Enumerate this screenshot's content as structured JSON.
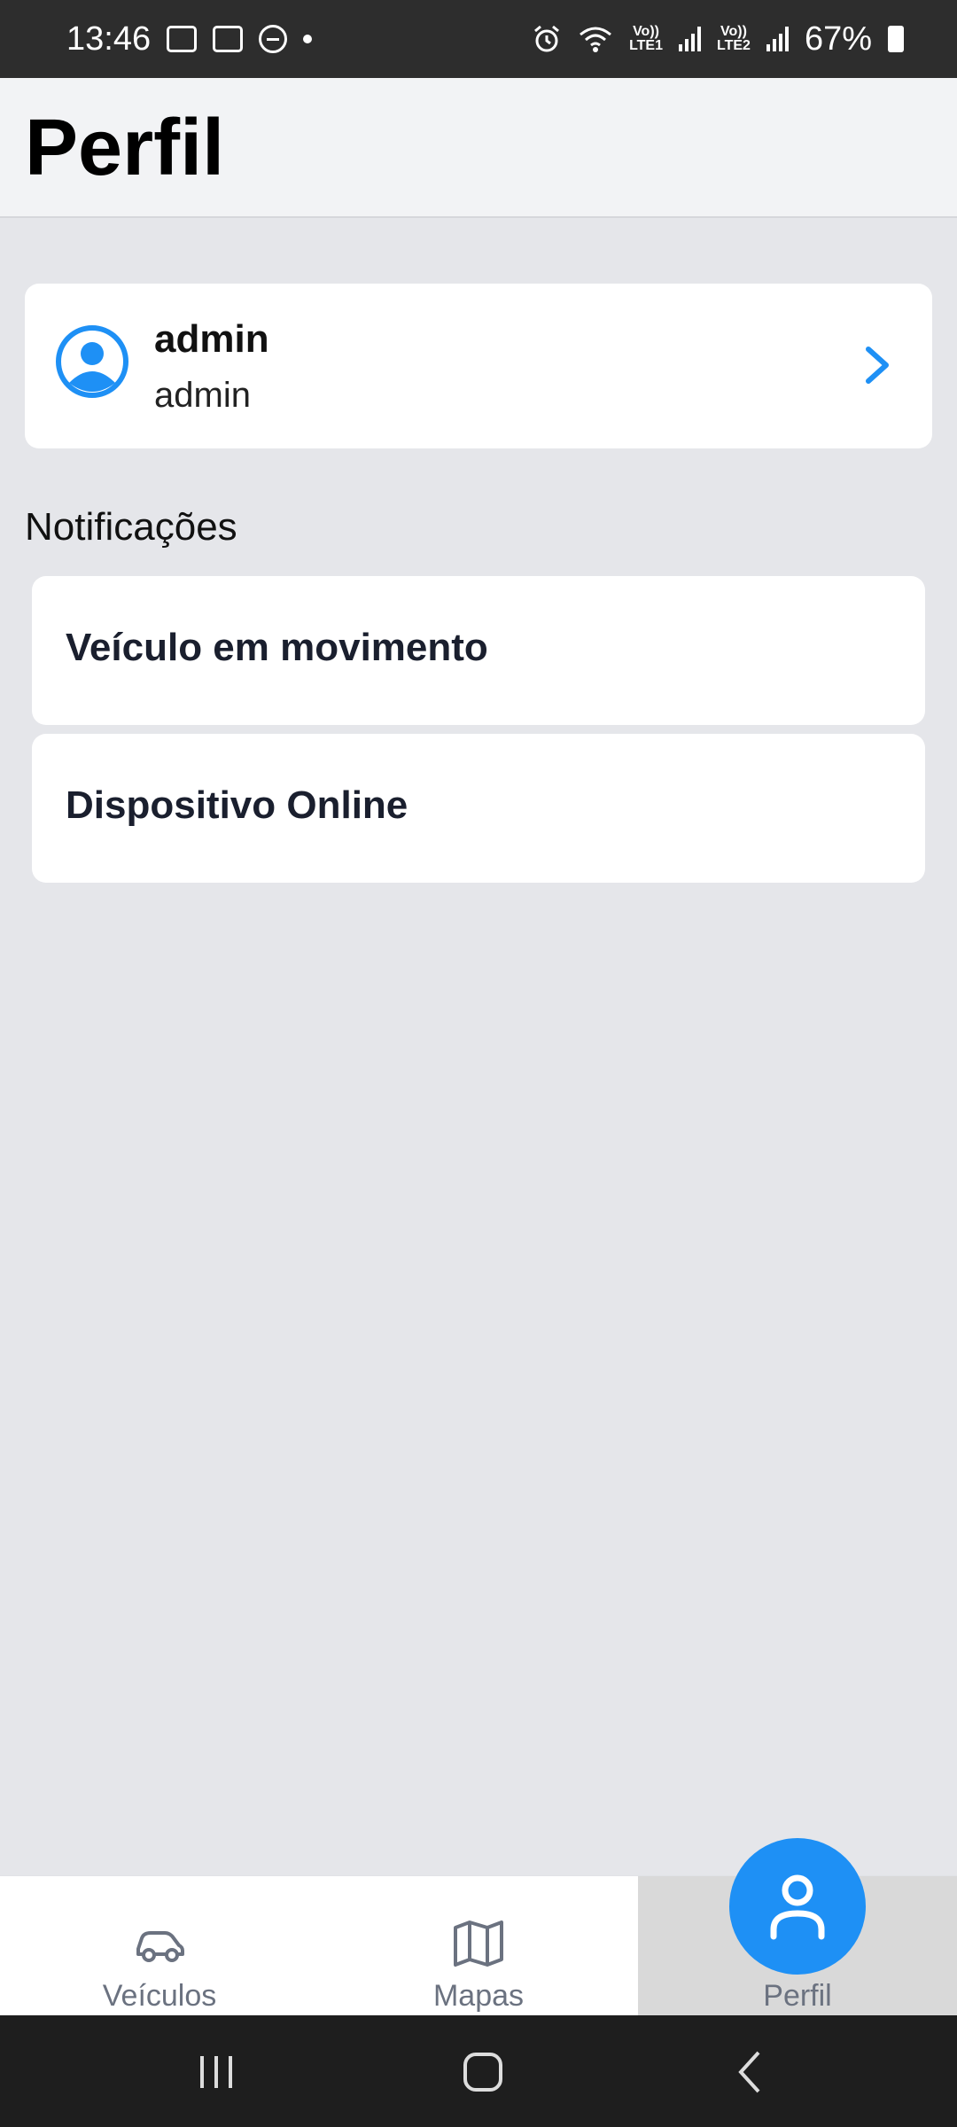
{
  "status_bar": {
    "time": "13:46",
    "lte1": "Vo))\nLTE1",
    "lte2": "Vo))\nLTE2",
    "battery": "67%"
  },
  "header": {
    "title": "Perfil"
  },
  "profile": {
    "name": "admin",
    "role": "admin",
    "accent_color": "#1e90f5"
  },
  "notifications": {
    "section_label": "Notificações",
    "items": [
      {
        "label": "Veículo em movimento"
      },
      {
        "label": "Dispositivo Online"
      }
    ]
  },
  "bottom_nav": {
    "items": [
      {
        "label": "Veículos",
        "icon": "car-icon"
      },
      {
        "label": "Mapas",
        "icon": "map-icon"
      },
      {
        "label": "Perfil",
        "icon": "user-icon",
        "active": true
      }
    ]
  }
}
